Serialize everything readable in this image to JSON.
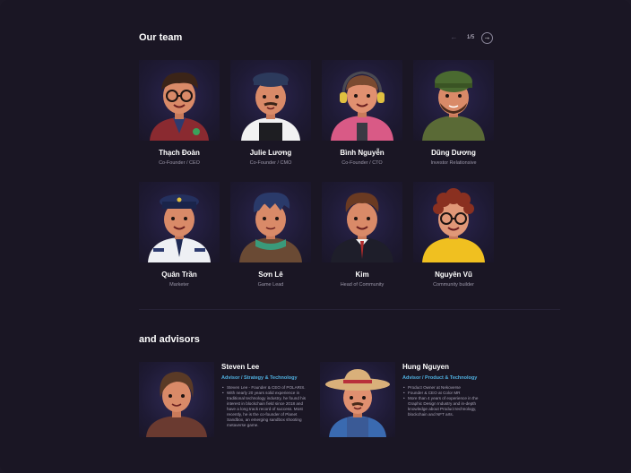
{
  "team": {
    "title": "Our team",
    "pager": {
      "current": "1/5",
      "prev_icon": "arrow-left-icon",
      "next_icon": "arrow-right-icon"
    },
    "members": [
      {
        "name": "Thạch Đoàn",
        "role": "Co-Founder / CEO"
      },
      {
        "name": "Julie Lương",
        "role": "Co-Founder / CMO"
      },
      {
        "name": "Bình Nguyễn",
        "role": "Co-Founder / CTO"
      },
      {
        "name": "Dũng Dương",
        "role": "Investor Relationsive"
      },
      {
        "name": "Quân Trần",
        "role": "Marketer"
      },
      {
        "name": "Sơn Lê",
        "role": "Game Lead"
      },
      {
        "name": "Kim",
        "role": "Head of Community"
      },
      {
        "name": "Nguyên Vũ",
        "role": "Community builder"
      }
    ]
  },
  "advisors": {
    "title": "and advisors",
    "items": [
      {
        "name": "Steven Lee",
        "role": "Advisor / Strategy & Technology",
        "bullets": [
          "Steven Lee - Founder & CEO of POLARIS.",
          "With nearly 20 years solid experience in traditional technology industry, he found his interest in blockchain field since 2018 and have a long track record of success. Most recently, he is the co-founder of Planet Sandbox, an emerging sandbox shooting metaverse game."
        ]
      },
      {
        "name": "Hung Nguyen",
        "role": "Advisor / Product & Technology",
        "bullets": [
          "Product Owner at Nekoverse",
          "Founder & CEO at Color MR",
          "More than 4 years of experience in the Graphic Design Industry and in-depth knowledge about Product technology, blockchain and NFT arts."
        ]
      }
    ]
  },
  "colors": {
    "background": "#1a1624",
    "accent_role": "#4fb0e0",
    "muted_text": "#9a96a8"
  }
}
